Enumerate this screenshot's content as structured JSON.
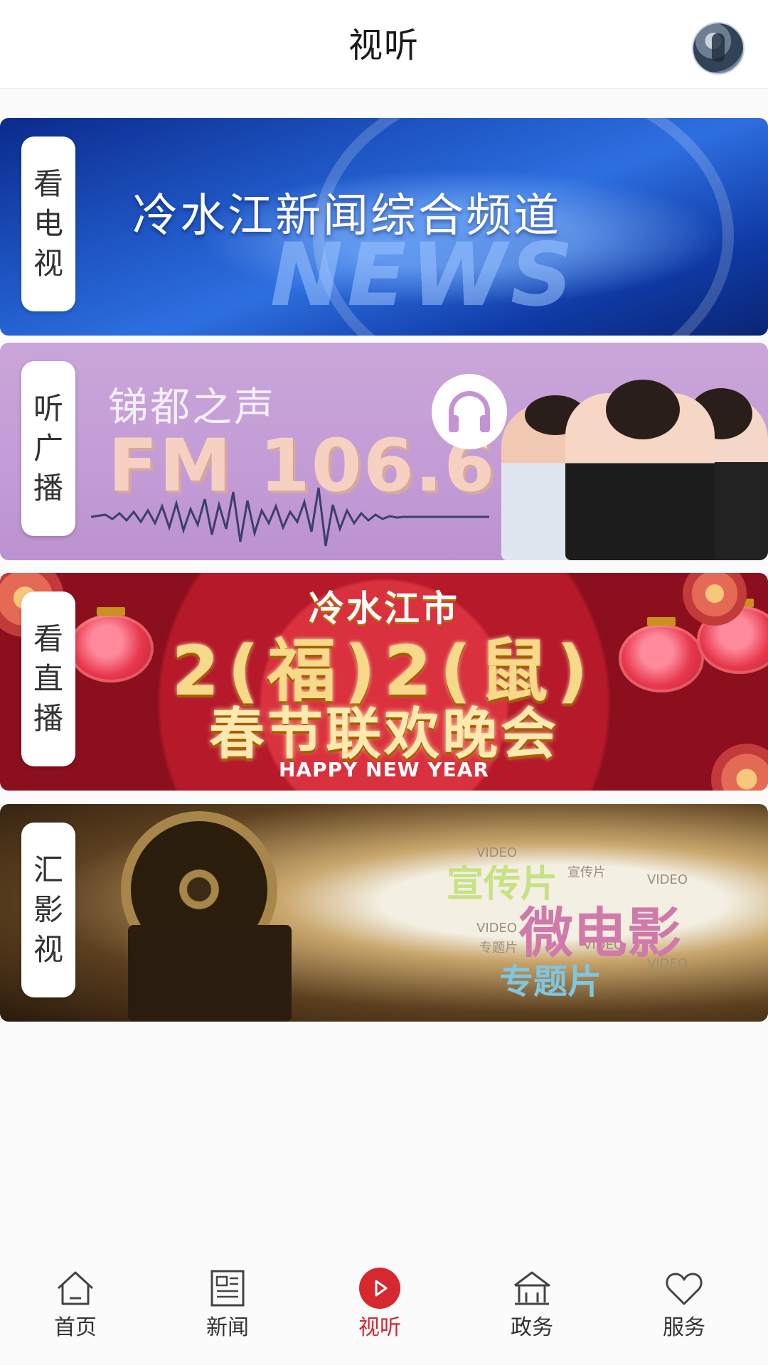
{
  "header": {
    "title": "视听"
  },
  "banners": [
    {
      "side_label": [
        "看",
        "电",
        "视"
      ],
      "title": "冷水江新闻综合频道",
      "bg_word": "NEWS"
    },
    {
      "side_label": [
        "听",
        "广",
        "播"
      ],
      "subtitle": "锑都之声",
      "frequency": "FM 106.6"
    },
    {
      "side_label": [
        "看",
        "直",
        "播"
      ],
      "top": "冷水江市",
      "year": "2(福)2(鼠)",
      "title": "春节联欢晚会",
      "english": "HAPPY NEW YEAR"
    },
    {
      "side_label": [
        "汇",
        "影",
        "视"
      ],
      "word1": "宣传片",
      "word2": "微电影",
      "word3": "专题片",
      "small": [
        "VIDEO",
        "宣传片",
        "VIDEO",
        "VIDEO",
        "专题片",
        "VIDEO",
        "VIDEO"
      ]
    }
  ],
  "tabbar": {
    "items": [
      {
        "label": "首页",
        "icon": "home-icon"
      },
      {
        "label": "新闻",
        "icon": "newspaper-icon"
      },
      {
        "label": "视听",
        "icon": "play-icon",
        "active": true
      },
      {
        "label": "政务",
        "icon": "government-icon"
      },
      {
        "label": "服务",
        "icon": "heart-icon"
      }
    ]
  },
  "colors": {
    "accent": "#d5282f",
    "text": "#333333"
  }
}
